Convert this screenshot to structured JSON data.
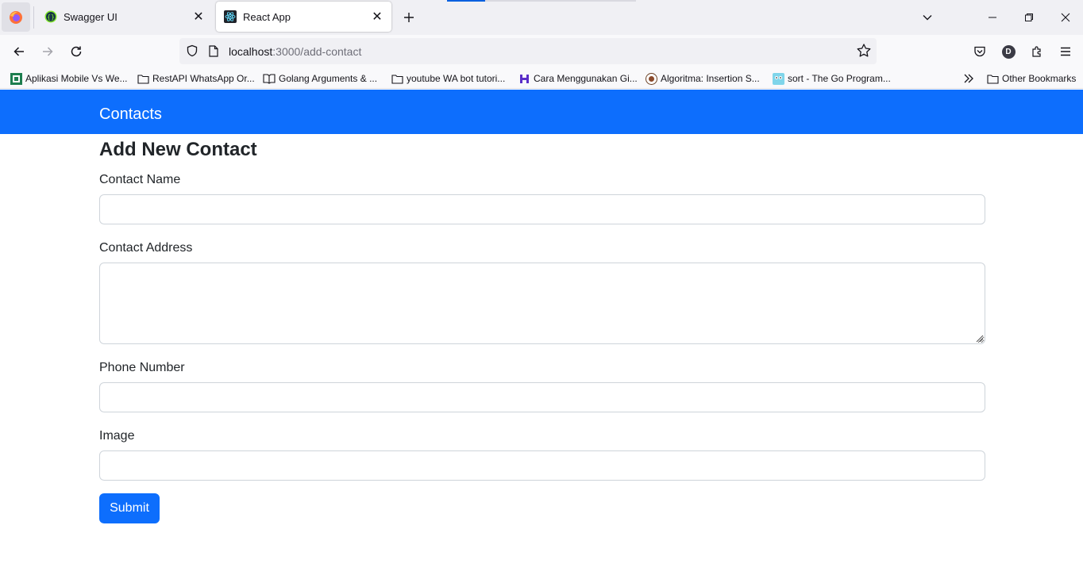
{
  "browser": {
    "tabs": [
      {
        "title": "Swagger UI",
        "active": false
      },
      {
        "title": "React App",
        "active": true
      }
    ],
    "url": {
      "host": "localhost",
      "path": ":3000/add-contact"
    },
    "profile_initial": "D",
    "bookmarks": [
      {
        "label": "Aplikasi Mobile Vs We...",
        "icon": "green-square-icon"
      },
      {
        "label": "RestAPI WhatsApp Or...",
        "icon": "folder-icon"
      },
      {
        "label": "Golang Arguments & ...",
        "icon": "book-icon"
      },
      {
        "label": "youtube WA bot tutori...",
        "icon": "folder-icon"
      },
      {
        "label": "Cara Menggunakan Gi...",
        "icon": "purple-logo-icon"
      },
      {
        "label": "Algoritma: Insertion S...",
        "icon": "coffee-logo-icon"
      },
      {
        "label": "sort - The Go Program...",
        "icon": "gopher-icon"
      }
    ],
    "other_bookmarks": "Other Bookmarks"
  },
  "app": {
    "brand": "Contacts",
    "page_title": "Add New Contact",
    "form": {
      "name_label": "Contact Name",
      "name_value": "",
      "address_label": "Contact Address",
      "address_value": "",
      "phone_label": "Phone Number",
      "phone_value": "",
      "image_label": "Image",
      "image_value": "",
      "submit_label": "Submit"
    }
  },
  "colors": {
    "primary": "#0d6efd",
    "text": "#212529",
    "border": "#ced4da"
  }
}
